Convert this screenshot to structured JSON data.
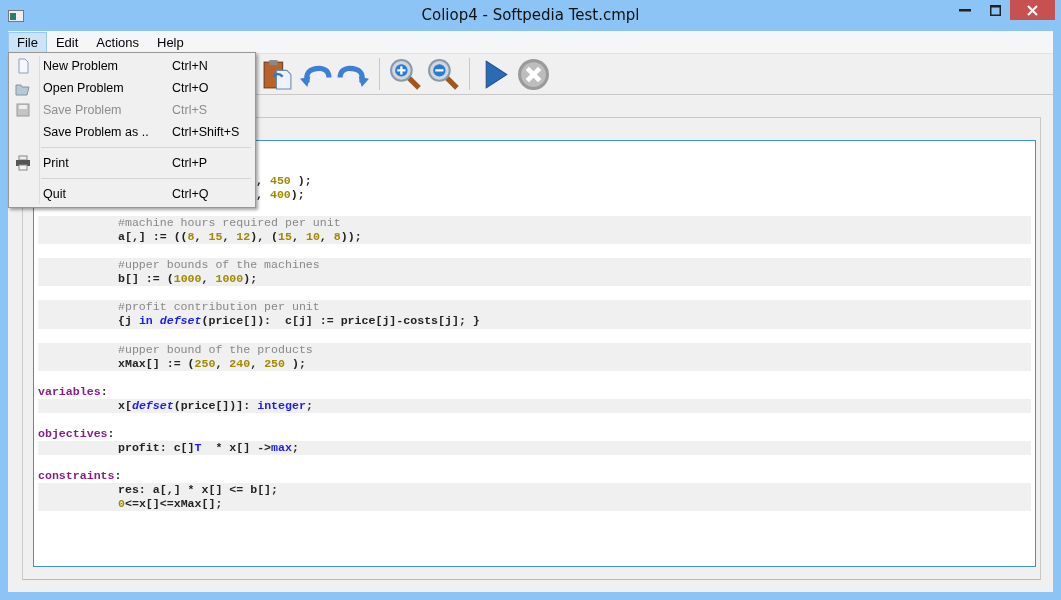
{
  "window": {
    "title": "Coliop4 - Softpedia Test.cmpl"
  },
  "menubar": [
    {
      "label": "File",
      "selected": true
    },
    {
      "label": "Edit",
      "selected": false
    },
    {
      "label": "Actions",
      "selected": false
    },
    {
      "label": "Help",
      "selected": false
    }
  ],
  "file_menu": [
    {
      "kind": "new",
      "label": "New Problem",
      "shortcut": "Ctrl+N",
      "disabled": false
    },
    {
      "kind": "open",
      "label": "Open Problem",
      "shortcut": "Ctrl+O",
      "disabled": false
    },
    {
      "kind": "save",
      "label": "Save Problem",
      "shortcut": "Ctrl+S",
      "disabled": true
    },
    {
      "kind": "plain",
      "label": "Save Problem as ..",
      "shortcut": "Ctrl+Shift+S",
      "disabled": false
    },
    {
      "kind": "separator"
    },
    {
      "kind": "print",
      "label": "Print",
      "shortcut": "Ctrl+P",
      "disabled": false
    },
    {
      "kind": "separator"
    },
    {
      "kind": "plain",
      "label": "Quit",
      "shortcut": "Ctrl+Q",
      "disabled": false
    }
  ],
  "toolbar": [
    {
      "kind": "paste"
    },
    {
      "kind": "undo"
    },
    {
      "kind": "redo"
    },
    {
      "kind": "separator"
    },
    {
      "kind": "zoom-in"
    },
    {
      "kind": "zoom-out"
    },
    {
      "kind": "separator"
    },
    {
      "kind": "run"
    },
    {
      "kind": "stop"
    }
  ],
  "editor": {
    "lines": [
      {
        "kind": "tail",
        "tokens": [
          {
            "t": ", ",
            "kind": "plain"
          },
          {
            "t": "450",
            "kind": "number"
          },
          {
            "t": " );",
            "kind": "plain"
          }
        ]
      },
      {
        "kind": "tail",
        "tokens": [
          {
            "t": ", ",
            "kind": "plain"
          },
          {
            "t": "400",
            "kind": "number"
          },
          {
            "t": ");",
            "kind": "plain"
          }
        ]
      },
      {
        "kind": "blank"
      },
      {
        "kind": "body",
        "tokens": [
          {
            "t": "#machine hours required per unit",
            "kind": "comment"
          }
        ]
      },
      {
        "kind": "body",
        "tokens": [
          {
            "t": "a[,] := ((",
            "kind": "plain"
          },
          {
            "t": "8",
            "kind": "number"
          },
          {
            "t": ", ",
            "kind": "plain"
          },
          {
            "t": "15",
            "kind": "number"
          },
          {
            "t": ", ",
            "kind": "plain"
          },
          {
            "t": "12",
            "kind": "number"
          },
          {
            "t": "), (",
            "kind": "plain"
          },
          {
            "t": "15",
            "kind": "number"
          },
          {
            "t": ", ",
            "kind": "plain"
          },
          {
            "t": "10",
            "kind": "number"
          },
          {
            "t": ", ",
            "kind": "plain"
          },
          {
            "t": "8",
            "kind": "number"
          },
          {
            "t": "));",
            "kind": "plain"
          }
        ]
      },
      {
        "kind": "blank"
      },
      {
        "kind": "body",
        "tokens": [
          {
            "t": "#upper bounds of the machines",
            "kind": "comment"
          }
        ]
      },
      {
        "kind": "body",
        "tokens": [
          {
            "t": "b[] := (",
            "kind": "plain"
          },
          {
            "t": "1000",
            "kind": "number"
          },
          {
            "t": ", ",
            "kind": "plain"
          },
          {
            "t": "1000",
            "kind": "number"
          },
          {
            "t": ");",
            "kind": "plain"
          }
        ]
      },
      {
        "kind": "blank"
      },
      {
        "kind": "body",
        "tokens": [
          {
            "t": "#profit contribution per unit",
            "kind": "comment"
          }
        ]
      },
      {
        "kind": "body",
        "tokens": [
          {
            "t": "{j ",
            "kind": "plain"
          },
          {
            "t": "in ",
            "kind": "keyword"
          },
          {
            "t": "defset",
            "kind": "function"
          },
          {
            "t": "(price[]):  c[j] := price[j]-costs[j]; }",
            "kind": "plain"
          }
        ]
      },
      {
        "kind": "blank"
      },
      {
        "kind": "body",
        "tokens": [
          {
            "t": "#upper bound of the products",
            "kind": "comment"
          }
        ]
      },
      {
        "kind": "body",
        "tokens": [
          {
            "t": "xMax[] := (",
            "kind": "plain"
          },
          {
            "t": "250",
            "kind": "number"
          },
          {
            "t": ", ",
            "kind": "plain"
          },
          {
            "t": "240",
            "kind": "number"
          },
          {
            "t": ", ",
            "kind": "plain"
          },
          {
            "t": "250",
            "kind": "number"
          },
          {
            "t": " );",
            "kind": "plain"
          }
        ]
      },
      {
        "kind": "blank"
      },
      {
        "kind": "section",
        "tokens": [
          {
            "t": "variables",
            "kind": "section"
          },
          {
            "t": ":",
            "kind": "plain"
          }
        ]
      },
      {
        "kind": "body",
        "tokens": [
          {
            "t": "x[",
            "kind": "plain"
          },
          {
            "t": "defset",
            "kind": "function"
          },
          {
            "t": "(price[])]: ",
            "kind": "plain"
          },
          {
            "t": "integer",
            "kind": "keyword"
          },
          {
            "t": ";",
            "kind": "plain"
          }
        ]
      },
      {
        "kind": "blank"
      },
      {
        "kind": "section",
        "tokens": [
          {
            "t": "objectives",
            "kind": "section"
          },
          {
            "t": ":",
            "kind": "plain"
          }
        ]
      },
      {
        "kind": "body",
        "tokens": [
          {
            "t": "profit: c[]",
            "kind": "plain"
          },
          {
            "t": "T",
            "kind": "keyword"
          },
          {
            "t": "  * x[] ->",
            "kind": "plain"
          },
          {
            "t": "max",
            "kind": "keyword"
          },
          {
            "t": ";",
            "kind": "plain"
          }
        ]
      },
      {
        "kind": "blank"
      },
      {
        "kind": "section",
        "tokens": [
          {
            "t": "constraints",
            "kind": "section"
          },
          {
            "t": ":",
            "kind": "plain"
          }
        ]
      },
      {
        "kind": "body",
        "tokens": [
          {
            "t": "res: a[,] * x[] <= b[];",
            "kind": "plain"
          }
        ]
      },
      {
        "kind": "body",
        "tokens": [
          {
            "t": "0",
            "kind": "number"
          },
          {
            "t": "<=x[]<=xMax[];",
            "kind": "plain"
          }
        ]
      }
    ]
  }
}
